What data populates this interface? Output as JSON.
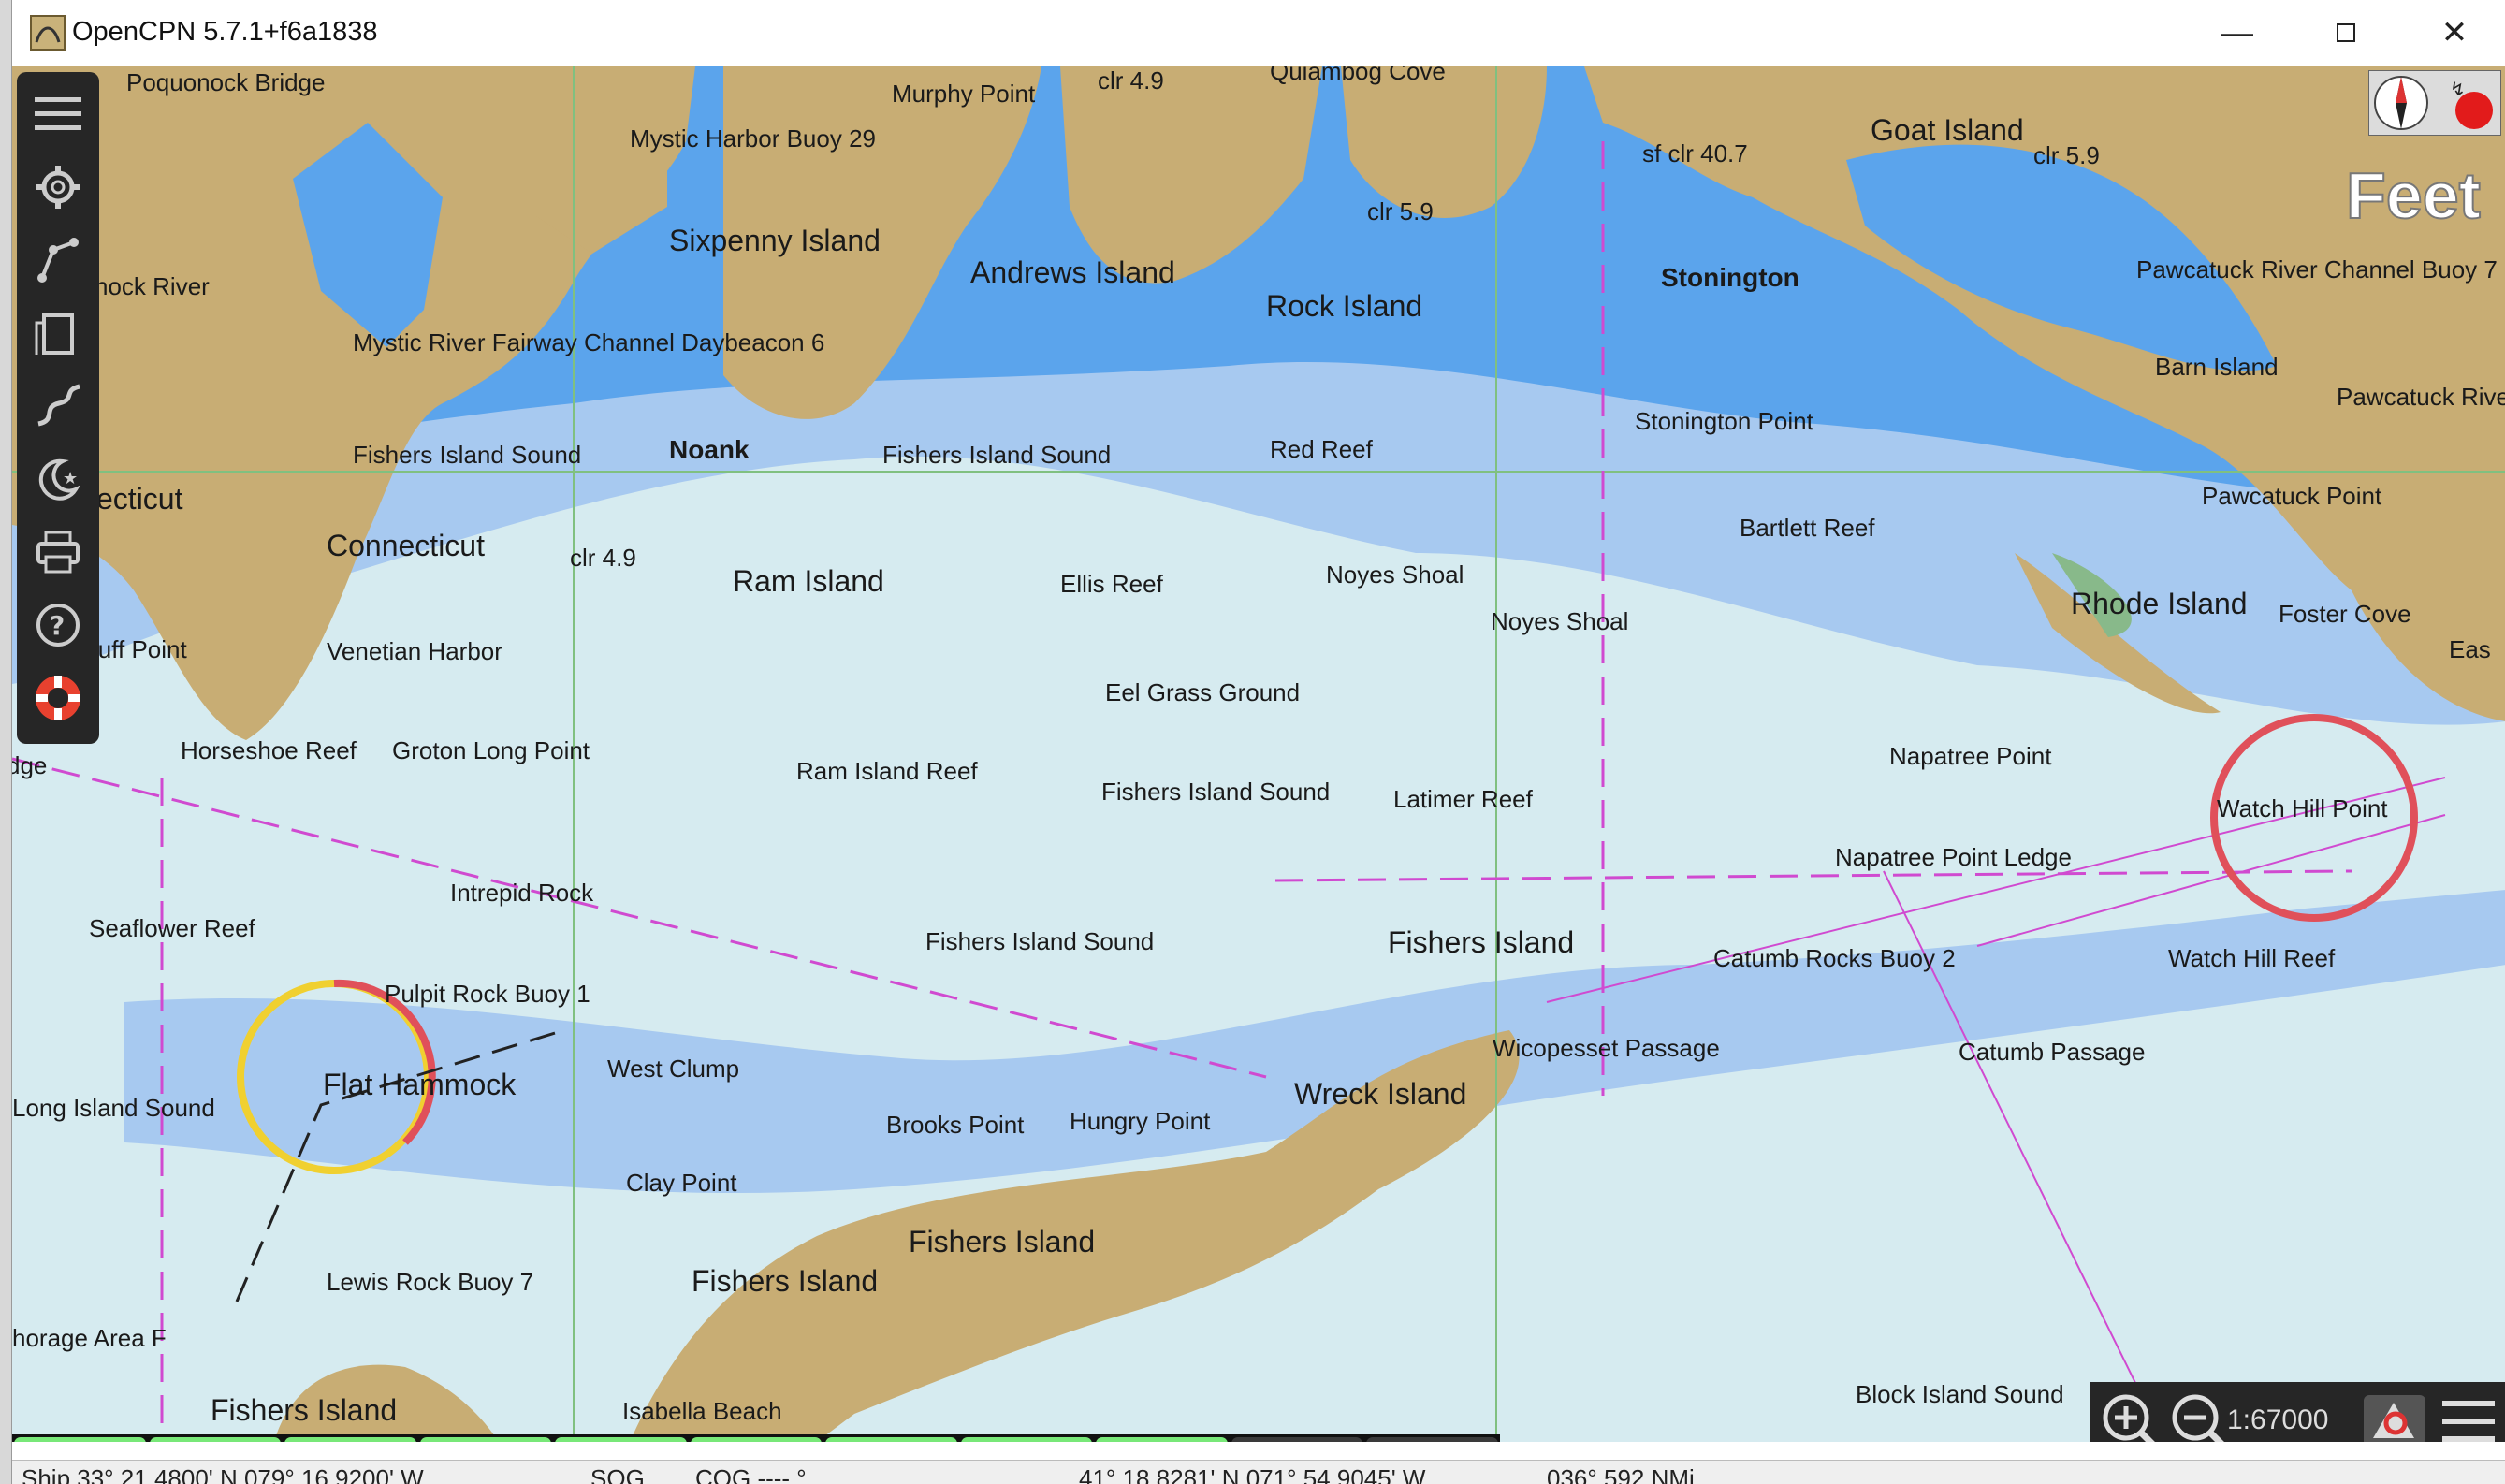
{
  "window": {
    "title": "OpenCPN 5.7.1+f6a1838",
    "minimize_icon": "minimize-icon",
    "maximize_icon": "maximize-icon",
    "close_icon": "close-icon"
  },
  "toolbar": {
    "items": [
      {
        "name": "menu-hamburger-icon"
      },
      {
        "name": "settings-gear-icon"
      },
      {
        "name": "route-manager-icon"
      },
      {
        "name": "chart-book-icon"
      },
      {
        "name": "track-icon"
      },
      {
        "name": "moon-star-icon"
      },
      {
        "name": "printer-icon"
      },
      {
        "name": "help-question-icon"
      },
      {
        "name": "life-ring-icon"
      }
    ]
  },
  "chart": {
    "units_label": "Feet",
    "scale": "1:67000",
    "labels": [
      "Poquonock Bridge",
      "Murphy Point",
      "clr 4.9",
      "Quiambog Cove",
      "Mystic Harbor Buoy 29",
      "Goat Island",
      "sf clr 40.7",
      "clr 5.9",
      "Sixpenny Island",
      "Andrews Island",
      "clr 5.9",
      "Rock Island",
      "Stonington",
      "Pawcatuck River Channel Buoy 7",
      "nock River",
      "Mystic River Fairway Channel Daybeacon 6",
      "Barn Island",
      "Pawcatuck River",
      "Stonington Point",
      "Fishers Island Sound",
      "Noank",
      "Fishers Island Sound",
      "Red Reef",
      "ecticut",
      "Bartlett Reef",
      "Pawcatuck Point",
      "Connecticut",
      "clr 4.9",
      "Ram Island",
      "Ellis Reef",
      "Noyes Shoal",
      "Noyes Shoal",
      "Rhode Island",
      "Foster Cove",
      "luff Point",
      "Venetian Harbor",
      "Eel Grass Ground",
      "Eas",
      "Horseshoe Reef",
      "Groton Long Point",
      "Napatree Point",
      "dge",
      "Ram Island Reef",
      "Fishers Island Sound",
      "Latimer Reef",
      "Watch Hill Point",
      "Napatree Point Ledge",
      "Intrepid Rock",
      "Seaflower Reef",
      "Fishers Island Sound",
      "Fishers Island",
      "Catumb Rocks Buoy 2",
      "Watch Hill Reef",
      "Pulpit Rock Buoy 1",
      "Wicopesset Passage",
      "Catumb Passage",
      "West Clump",
      "Flat Hammock",
      "Long Island Sound",
      "Wreck Island",
      "Brooks Point",
      "Hungry Point",
      "Clay Point",
      "Fishers Island",
      "Lewis Rock Buoy 7",
      "Fishers Island",
      "horage Area F",
      "Block Island Sound",
      "Fishers Island",
      "Isabella Beach"
    ]
  },
  "progress": {
    "segments_on": 9,
    "segments_total": 11
  },
  "status": {
    "ship": "Ship 33° 21.4800' N   079° 16.9200' W",
    "sog": "SOG",
    "cog": "COG ---- °",
    "cursor": "41° 18.8281' N   071° 54.9045' W",
    "bearing": "036°  592 NMi"
  }
}
